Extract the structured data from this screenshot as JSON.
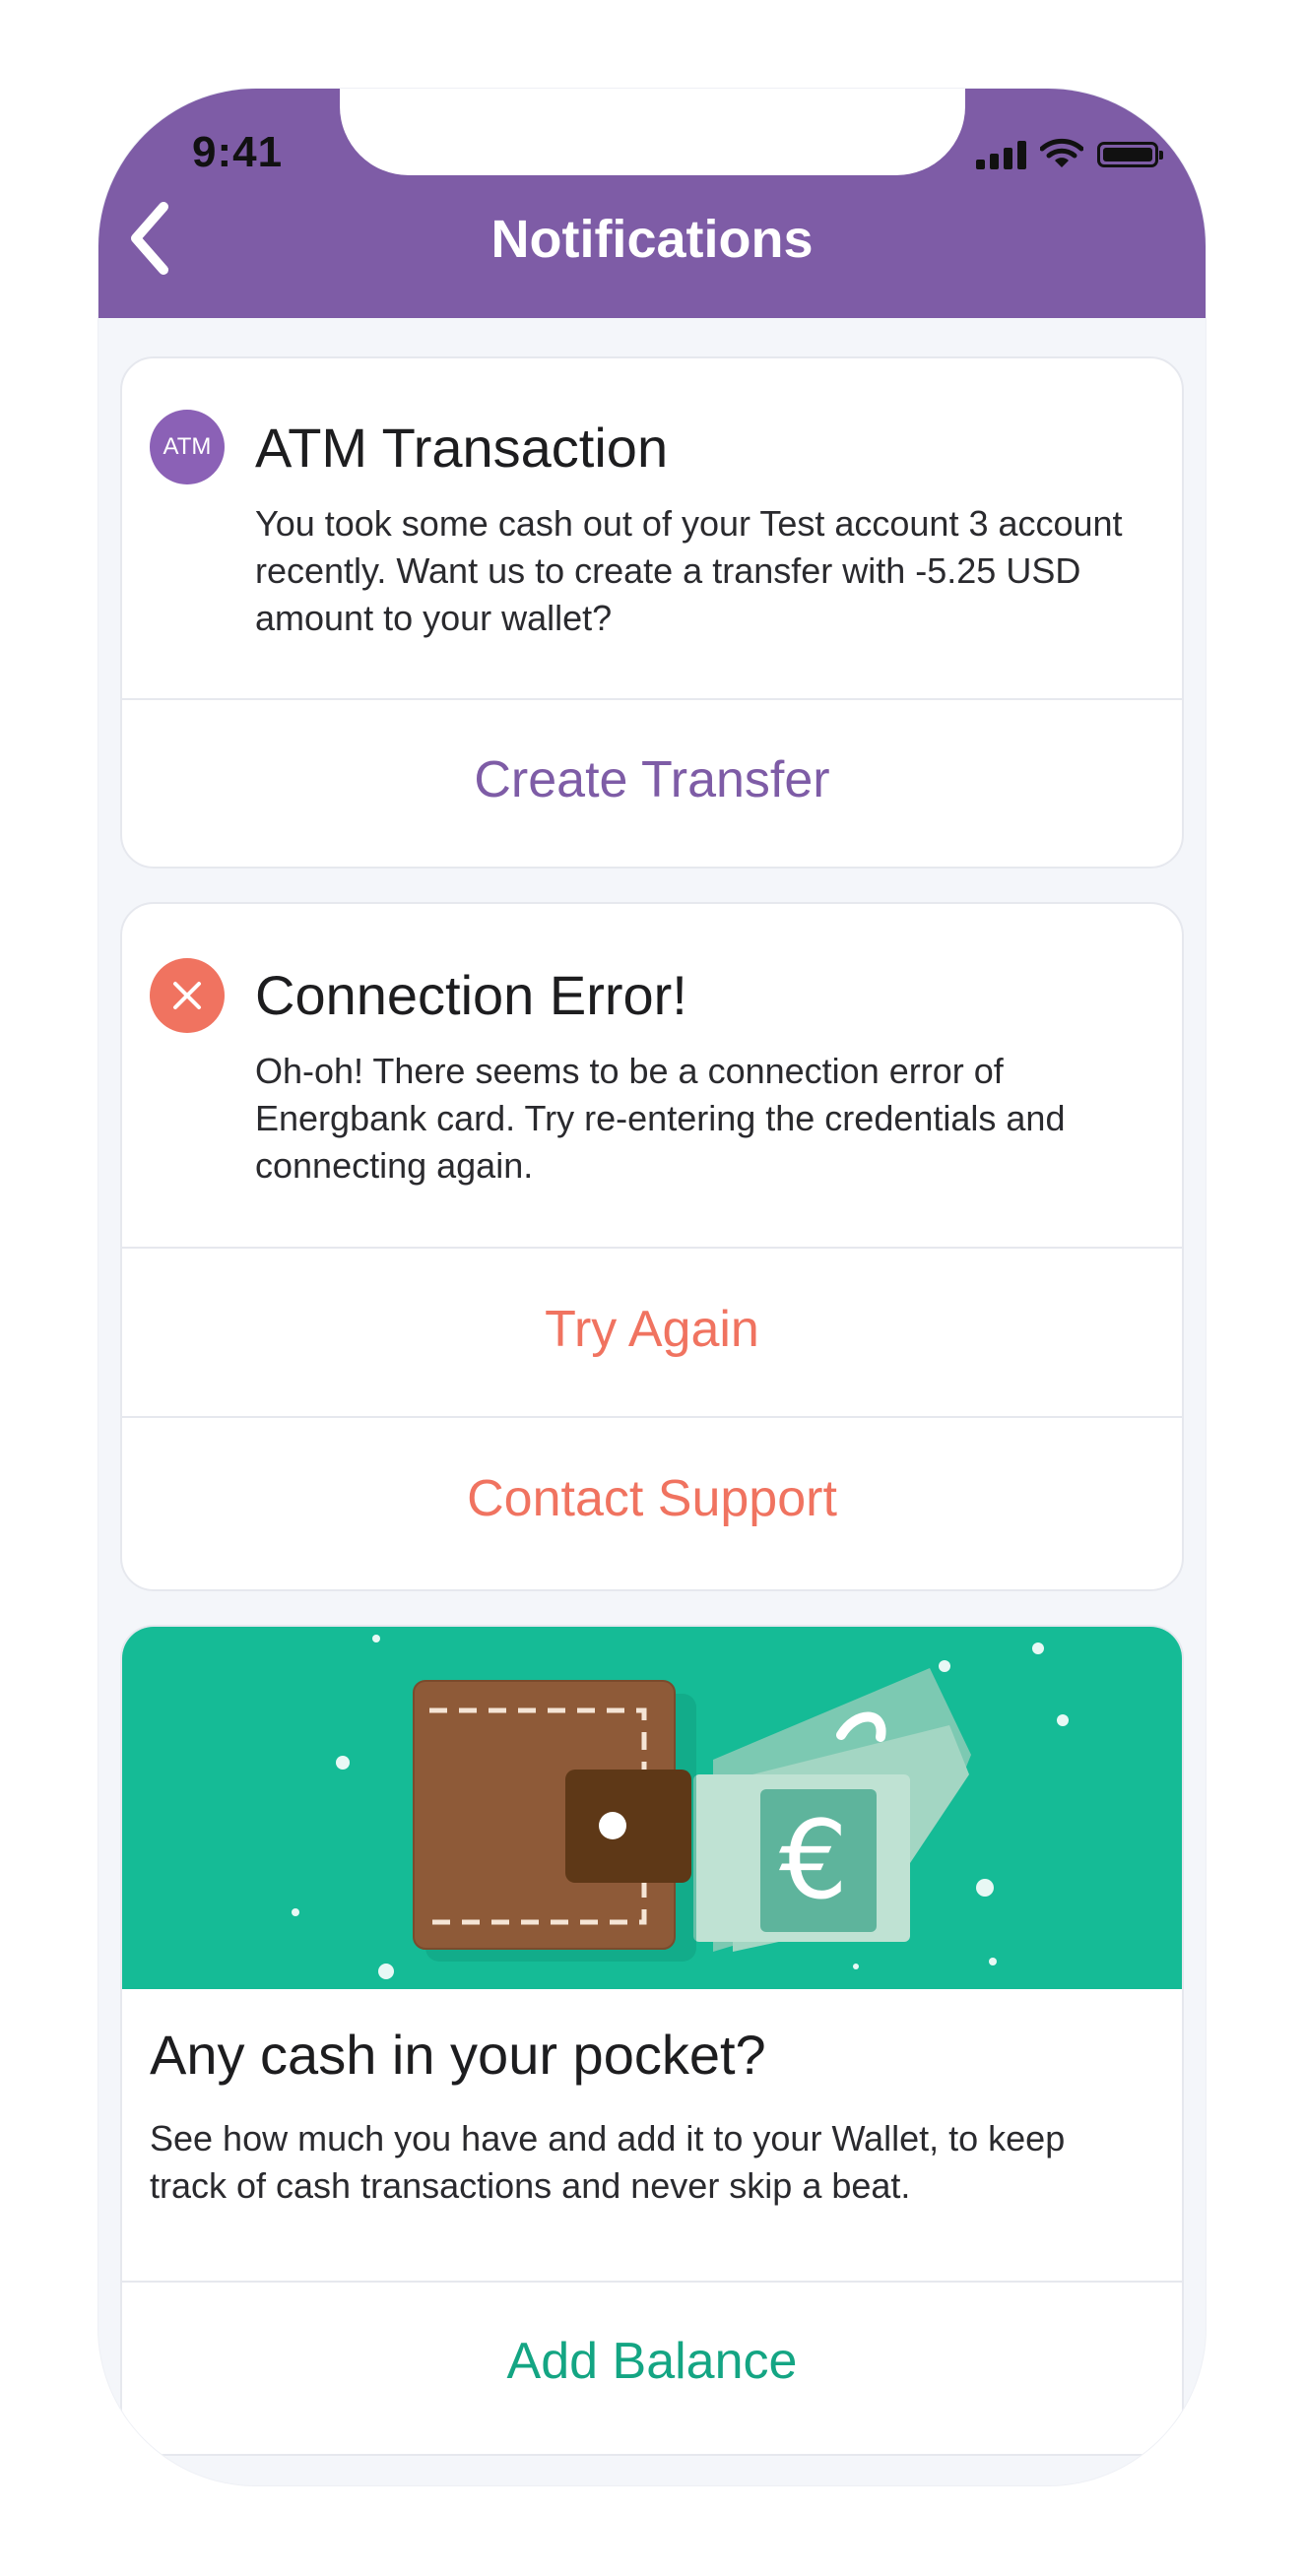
{
  "status_bar": {
    "time": "9:41"
  },
  "header": {
    "title": "Notifications",
    "back_icon": "chevron-left-icon"
  },
  "colors": {
    "header": "#7e5ca6",
    "accent_purple": "#7e5ca6",
    "error": "#f07360",
    "green": "#15bb96",
    "green_text": "#14a583"
  },
  "notifications": [
    {
      "icon_label": "ATM",
      "title": "ATM Transaction",
      "body": "You took some cash out of your Test account 3 account recently. Want us to create a transfer with -5.25 USD amount to your wallet?",
      "actions": [
        "Create Transfer"
      ]
    },
    {
      "icon": "close-icon",
      "title": "Connection Error!",
      "body": "Oh-oh! There seems to be a connection error of Energbank card. Try re-entering the credentials and connecting again.",
      "actions": [
        "Try Again",
        "Contact Support"
      ]
    }
  ],
  "promo": {
    "illustration": "wallet-cash-illustration",
    "title": "Any cash in your pocket?",
    "body": "See how much you have and add it to your Wallet, to keep track of cash transactions and never skip a beat.",
    "action": "Add Balance"
  }
}
